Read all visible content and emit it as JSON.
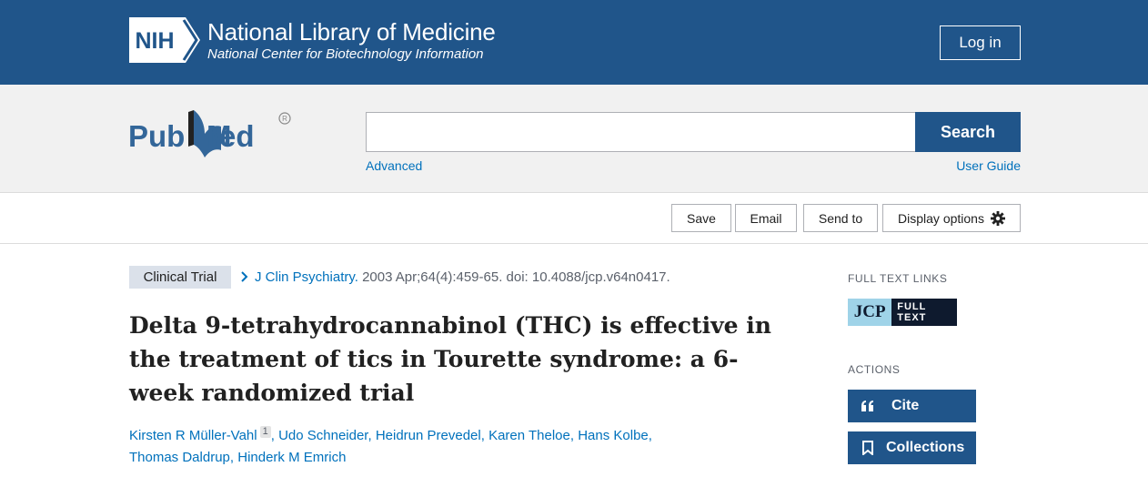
{
  "nih_header": {
    "logo_text": "NIH",
    "title": "National Library of Medicine",
    "subtitle": "National Center for Biotechnology Information",
    "login_label": "Log in"
  },
  "search_bar": {
    "logo_text": "PubMed",
    "query_value": "",
    "search_label": "Search",
    "advanced_label": "Advanced",
    "user_guide_label": "User Guide"
  },
  "toolbar": {
    "save_label": "Save",
    "email_label": "Email",
    "send_to_label": "Send to",
    "display_options_label": "Display options",
    "display_options_icon": "gear-icon"
  },
  "article": {
    "publication_type": "Clinical Trial",
    "journal": "J Clin Psychiatry.",
    "citation_details": " 2003 Apr;64(4):459-65. doi: 10.4088/jcp.v64n0417.",
    "title": "Delta 9-tetrahydrocannabinol (THC) is effective in the treatment of tics in Tourette syndrome: a 6-week randomized trial",
    "authors": [
      {
        "name": "Kirsten R Müller-Vahl",
        "affiliation": "1"
      },
      {
        "name": "Udo Schneider"
      },
      {
        "name": "Heidrun Prevedel"
      },
      {
        "name": "Karen Theloe"
      },
      {
        "name": "Hans Kolbe"
      },
      {
        "name": "Thomas Daldrup"
      },
      {
        "name": "Hinderk M Emrich"
      }
    ]
  },
  "sidebar": {
    "full_text_links_heading": "FULL TEXT LINKS",
    "full_text_badge": {
      "logo": "JCP",
      "label": "FULL TEXT"
    },
    "actions_heading": "ACTIONS",
    "cite_label": "Cite",
    "collections_label": "Collections"
  },
  "colors": {
    "nih_blue": "#20558a",
    "link_blue": "#0071bc",
    "band_gray": "#f1f1f1",
    "pub_type_bg": "#dbe1ea"
  }
}
